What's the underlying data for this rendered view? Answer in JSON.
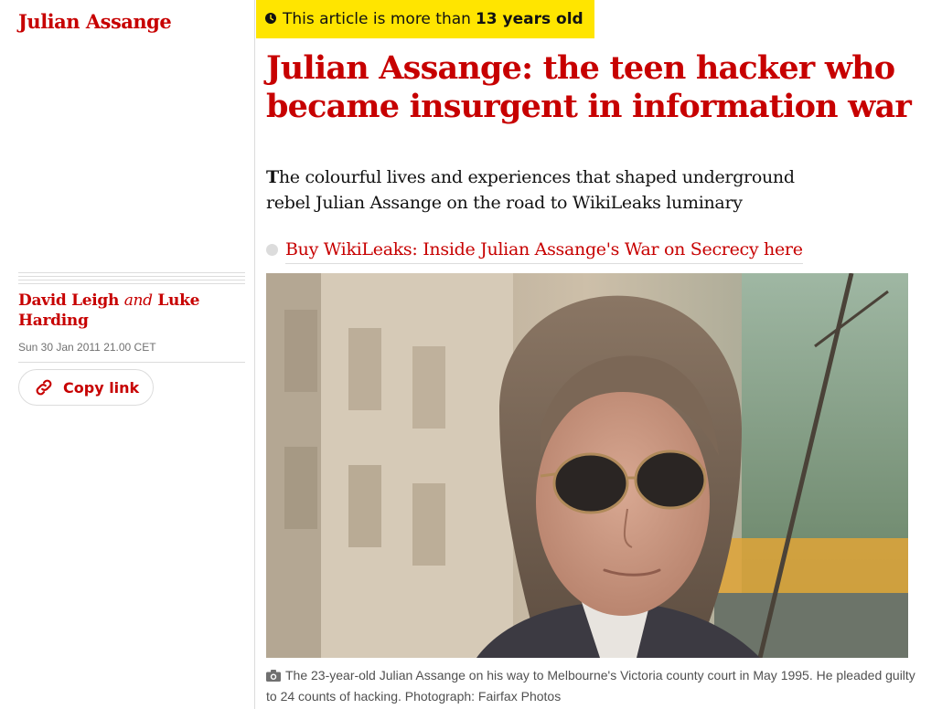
{
  "sidebar": {
    "section_label": "Julian Assange",
    "byline": {
      "author1": "David Leigh",
      "joiner": "and",
      "author2": "Luke Harding"
    },
    "dateline": "Sun 30 Jan 2011 21.00 CET",
    "copy_link_label": "Copy link"
  },
  "age_warning": {
    "prefix": "This article is more than",
    "age": "13 years old"
  },
  "article": {
    "headline": "Julian Assange: the teen hacker who became insurgent in information war",
    "standfirst_first_letter": "T",
    "standfirst_rest": "he colourful lives and experiences that shaped underground rebel Julian Assange on the road to WikiLeaks luminary",
    "related_link": "Buy WikiLeaks: Inside Julian Assange's War on Secrecy here"
  },
  "photo": {
    "caption": "The 23-year-old Julian Assange on his way to Melbourne's Victoria county court in May 1995. He pleaded guilty to 24 counts of hacking. Photograph: Fairfax Photos"
  },
  "icons": {
    "clock": "clock-icon",
    "link": "link-icon",
    "camera": "camera-icon"
  },
  "colors": {
    "accent_red": "#c70000",
    "age_warning_yellow": "#ffe500",
    "text": "#121212",
    "muted_text": "#707070",
    "rule": "#dcdcdc"
  }
}
